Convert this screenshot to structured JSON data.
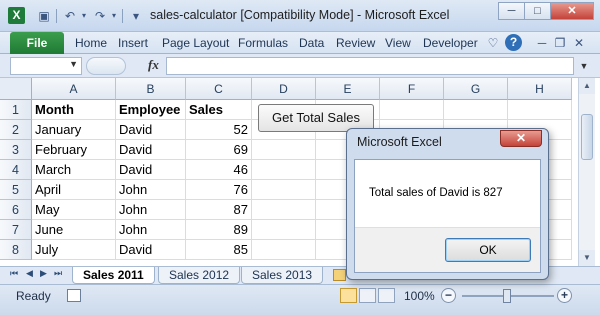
{
  "window": {
    "title": "sales-calculator  [Compatibility Mode] - Microsoft Excel",
    "logo": "X",
    "controls": {
      "minimize": "─",
      "maximize": "□",
      "close": "✕"
    }
  },
  "quick_access": {
    "save": "▣",
    "undo": "↶",
    "redo": "↷",
    "customize": "▾"
  },
  "ribbon": {
    "file": "File",
    "tabs": [
      "Home",
      "Insert",
      "Page Layout",
      "Formulas",
      "Data",
      "Review",
      "View",
      "Developer"
    ],
    "icons": {
      "heart": "♡",
      "help": "?",
      "min": "─",
      "restore": "❐",
      "close": "✕"
    }
  },
  "formula_bar": {
    "name_box": "",
    "fx": "fx",
    "formula": ""
  },
  "sheet": {
    "columns": [
      "A",
      "B",
      "C",
      "D",
      "E",
      "F",
      "G",
      "H"
    ],
    "rows": [
      "1",
      "2",
      "3",
      "4",
      "5",
      "6",
      "7",
      "8"
    ],
    "headers": [
      "Month",
      "Employee",
      "Sales"
    ],
    "data": [
      [
        "January",
        "David",
        "52"
      ],
      [
        "February",
        "David",
        "69"
      ],
      [
        "March",
        "David",
        "46"
      ],
      [
        "April",
        "John",
        "76"
      ],
      [
        "May",
        "John",
        "87"
      ],
      [
        "June",
        "John",
        "89"
      ],
      [
        "July",
        "David",
        "85"
      ]
    ],
    "button_label": "Get Total Sales"
  },
  "sheet_tabs": {
    "nav": [
      "⏮",
      "◀",
      "▶",
      "⏭"
    ],
    "tabs": [
      "Sales 2011",
      "Sales 2012",
      "Sales 2013"
    ],
    "active": "Sales 2011"
  },
  "status": {
    "ready": "Ready",
    "zoom": "100%",
    "zoom_minus": "−",
    "zoom_plus": "+"
  },
  "dialog": {
    "title": "Microsoft Excel",
    "close": "✕",
    "message": "Total sales of David is 827",
    "ok": "OK"
  }
}
